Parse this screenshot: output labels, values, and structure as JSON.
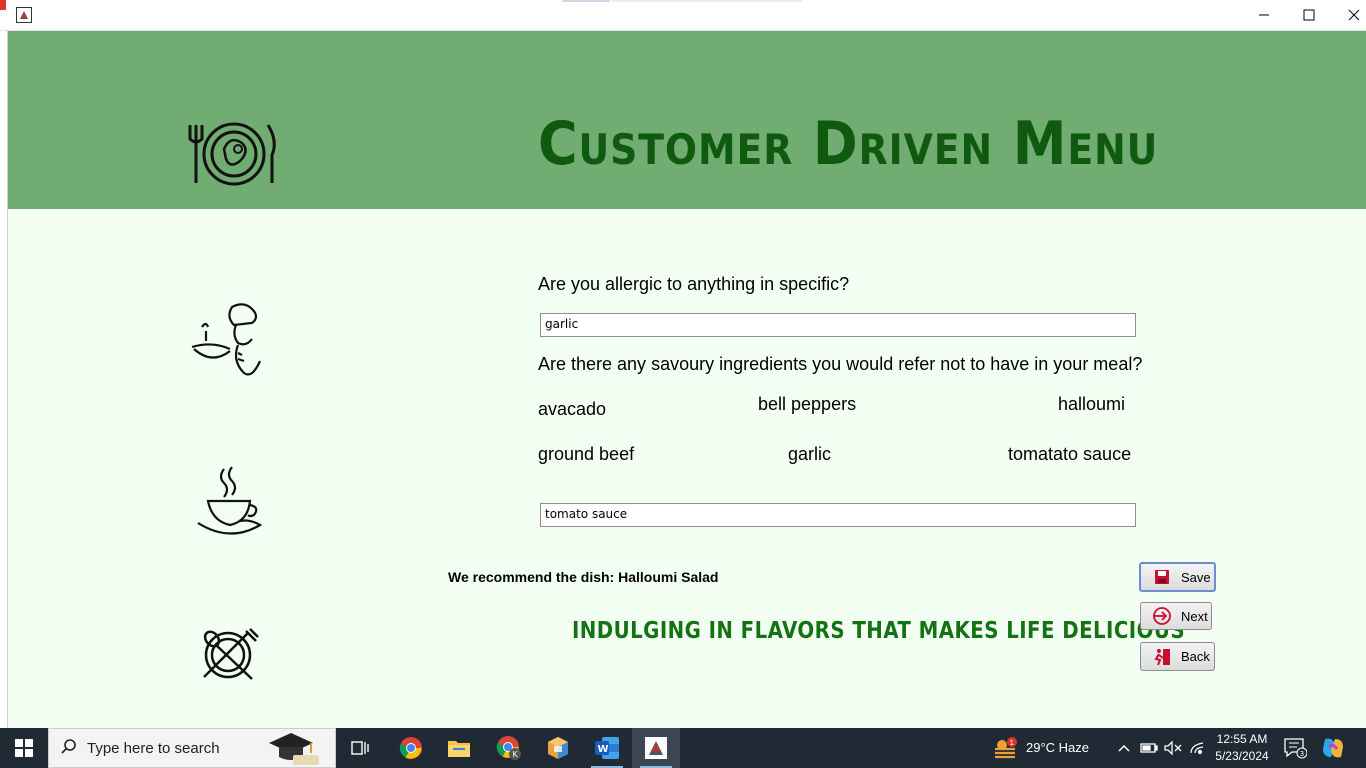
{
  "window": {
    "icon": "java-app-icon",
    "controls": [
      "minimize-icon",
      "maximize-icon",
      "close-icon"
    ]
  },
  "header": {
    "title": "Customer Driven Menu",
    "logo_icon": "plate-fork-knife-icon",
    "background": "#71ac72",
    "title_color": "#0f5a0f"
  },
  "form": {
    "allergy_question": "Are you allergic to anything in specific?",
    "allergy_value": "garlic",
    "savoury_question": "Are there any savoury ingredients you would refer not to have in your meal?",
    "options": [
      "avacado",
      "bell peppers",
      "halloumi",
      "ground beef",
      "garlic",
      "tomatato sauce"
    ],
    "savoury_value": "tomato sauce",
    "recommendation": "We recommend the dish: Halloumi Salad",
    "tagline": "INDULGING IN FLAVORS THAT MAKES LIFE DELICIOUS"
  },
  "buttons": {
    "save": "Save",
    "next": "Next",
    "back": "Back"
  },
  "side_icons": [
    "chef-icon",
    "coffee-cup-icon",
    "no-food-icon"
  ],
  "taskbar": {
    "search_placeholder": "Type here to search",
    "apps": [
      "task-view-icon",
      "chrome-icon",
      "file-explorer-icon",
      "chrome-profile-icon",
      "app-cube-icon",
      "word-icon",
      "java-app-icon"
    ],
    "weather": "29°C  Haze",
    "weather_badge": "1",
    "time": "12:55 AM",
    "date": "5/23/2024",
    "notifications": "3"
  },
  "colors": {
    "main_bg": "#f4fff4",
    "tagline": "#137313",
    "taskbar": "#1f2a34"
  }
}
